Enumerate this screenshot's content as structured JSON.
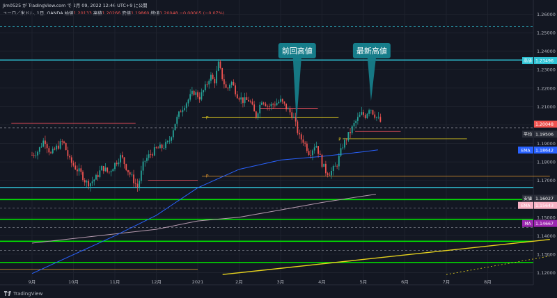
{
  "header": {
    "publish": "Jim0525 が TradingView.com で 2月 09, 2022 12:46 UTC+9 に公開",
    "symbol": "ユーロ／米ドル, 1日, OANDA",
    "open_label": "始値",
    "open": "1.20133",
    "high_label": "高値",
    "high": "1.20266",
    "low_label": "安値",
    "low": "1.19860",
    "close_label": "終値",
    "close": "1.20048",
    "change": "−0.00085 (−0.07%)"
  },
  "footer": {
    "brand": "TradingView"
  },
  "colors": {
    "background": "#131722",
    "up": "#26a69a",
    "down": "#ef5350",
    "cyan_line": "#2fc4d6",
    "green_line": "#00e600",
    "yellow_line": "#e6d21e",
    "ema_line": "#2962ff",
    "sma_line": "#b79bb0",
    "callout": "#167d8a"
  },
  "chart_data": {
    "type": "candlestick",
    "y_ticks": [
      "1.26000",
      "1.25000",
      "1.24000",
      "1.23000",
      "1.22000",
      "1.21000",
      "1.20000",
      "1.19000",
      "1.18000",
      "1.17000",
      "1.16000",
      "1.15000",
      "1.14000",
      "1.13000",
      "1.12000"
    ],
    "x_ticks": [
      "9月",
      "10月",
      "11月",
      "12月",
      "2021",
      "2月",
      "3月",
      "4月",
      "5月",
      "6月",
      "7月",
      "8月"
    ],
    "ylim": [
      1.1172,
      1.2652
    ],
    "price_labels": [
      {
        "name": "高値",
        "value": "1.23496",
        "price": 1.23496,
        "color": "#2fc4d6"
      },
      {
        "name": "",
        "value": "1.20048",
        "price": 1.20048,
        "color": "#ef5350"
      },
      {
        "name": "平均",
        "value": "1.19506",
        "price": 1.19506,
        "color": "#2a2e39"
      },
      {
        "name": "EMA",
        "value": "1.18642",
        "price": 1.18642,
        "color": "#2962ff"
      },
      {
        "name": "安値",
        "value": "1.16027",
        "price": 1.16027,
        "color": "#2a2e39"
      },
      {
        "name": "EMA",
        "value": "1.15643",
        "price": 1.15643,
        "color": "#f7b2c4"
      },
      {
        "name": "MA",
        "value": "1.14667",
        "price": 1.14667,
        "color": "#9c27b0"
      }
    ],
    "horizontal_lines": [
      {
        "price": 1.2352,
        "color": "#2fc4d6",
        "style": "solid"
      },
      {
        "price": 1.1661,
        "color": "#2fc4d6",
        "style": "solid"
      },
      {
        "price": 1.1596,
        "color": "#00e600",
        "style": "solid"
      },
      {
        "price": 1.1489,
        "color": "#00e600",
        "style": "solid"
      },
      {
        "price": 1.137,
        "color": "#00e600",
        "style": "solid"
      },
      {
        "price": 1.1255,
        "color": "#00e600",
        "style": "solid"
      },
      {
        "price": 1.2532,
        "color": "#2fc4d6",
        "style": "dashed"
      },
      {
        "price": 1.155,
        "color": "#787b86",
        "style": "dashed"
      },
      {
        "price": 1.1445,
        "color": "#787b86",
        "style": "dashed"
      },
      {
        "price": 1.132,
        "color": "#787b86",
        "style": "dashed"
      },
      {
        "price": 1.1985,
        "color": "#787b86",
        "style": "dashed"
      }
    ],
    "callouts": [
      {
        "text": "前回高値",
        "x_month": 6.4,
        "price": 1.2012
      },
      {
        "text": "最新高値",
        "x_month": 8.2,
        "price": 1.213
      }
    ],
    "pivot_marks": [
      {
        "text": "P",
        "x_month": 4.2,
        "price": 1.204,
        "color": "#e6d21e"
      },
      {
        "text": "P",
        "x_month": 7.4,
        "price": 1.1922,
        "color": "#e6d21e"
      },
      {
        "text": "P",
        "x_month": 4.2,
        "price": 1.1723,
        "color": "#f0a030"
      }
    ],
    "close_path": [
      [
        0,
        1.1838
      ],
      [
        0.15,
        1.186
      ],
      [
        0.3,
        1.1925
      ],
      [
        0.45,
        1.184
      ],
      [
        0.6,
        1.188
      ],
      [
        0.75,
        1.1912
      ],
      [
        0.9,
        1.181
      ],
      [
        1.05,
        1.1768
      ],
      [
        1.2,
        1.1732
      ],
      [
        1.3,
        1.1688
      ],
      [
        1.4,
        1.1685
      ],
      [
        1.55,
        1.1715
      ],
      [
        1.7,
        1.1772
      ],
      [
        1.85,
        1.174
      ],
      [
        2.0,
        1.179
      ],
      [
        2.15,
        1.1832
      ],
      [
        2.3,
        1.1758
      ],
      [
        2.45,
        1.17
      ],
      [
        2.55,
        1.1663
      ],
      [
        2.7,
        1.18
      ],
      [
        2.85,
        1.184
      ],
      [
        3.0,
        1.187
      ],
      [
        3.15,
        1.188
      ],
      [
        3.3,
        1.1905
      ],
      [
        3.45,
        1.201
      ],
      [
        3.6,
        1.2085
      ],
      [
        3.75,
        1.213
      ],
      [
        3.9,
        1.218
      ],
      [
        4.05,
        1.215
      ],
      [
        4.2,
        1.221
      ],
      [
        4.3,
        1.227
      ],
      [
        4.4,
        1.223
      ],
      [
        4.5,
        1.233
      ],
      [
        4.6,
        1.225
      ],
      [
        4.7,
        1.2185
      ],
      [
        4.8,
        1.224
      ],
      [
        4.95,
        1.2165
      ],
      [
        5.1,
        1.213
      ],
      [
        5.25,
        1.2135
      ],
      [
        5.4,
        1.2045
      ],
      [
        5.55,
        1.214
      ],
      [
        5.7,
        1.21
      ],
      [
        5.85,
        1.2115
      ],
      [
        6.0,
        1.213
      ],
      [
        6.15,
        1.209
      ],
      [
        6.3,
        1.205
      ],
      [
        6.45,
        1.1935
      ],
      [
        6.55,
        1.1915
      ],
      [
        6.7,
        1.1845
      ],
      [
        6.85,
        1.19
      ],
      [
        7.0,
        1.1792
      ],
      [
        7.1,
        1.1745
      ],
      [
        7.2,
        1.1742
      ],
      [
        7.35,
        1.178
      ],
      [
        7.5,
        1.189
      ],
      [
        7.65,
        1.195
      ],
      [
        7.8,
        1.2015
      ],
      [
        7.95,
        1.206
      ],
      [
        8.05,
        1.205
      ],
      [
        8.15,
        1.21
      ],
      [
        8.25,
        1.206
      ],
      [
        8.35,
        1.2035
      ],
      [
        8.45,
        1.2005
      ]
    ],
    "ema_line": [
      [
        0,
        1.1195
      ],
      [
        2,
        1.14
      ],
      [
        3,
        1.151
      ],
      [
        4,
        1.166
      ],
      [
        5,
        1.176
      ],
      [
        6,
        1.181
      ],
      [
        7,
        1.183
      ],
      [
        8,
        1.1855
      ],
      [
        8.35,
        1.1865
      ]
    ],
    "sma_line": [
      [
        0,
        1.136
      ],
      [
        3,
        1.1435
      ],
      [
        4,
        1.148
      ],
      [
        5,
        1.15
      ],
      [
        6,
        1.154
      ],
      [
        7,
        1.158
      ],
      [
        8,
        1.1615
      ],
      [
        8.3,
        1.1625
      ]
    ],
    "trend_yellow": [
      [
        4.6,
        1.119
      ],
      [
        12.5,
        1.138
      ]
    ],
    "trend_dotted": [
      [
        10,
        1.119
      ],
      [
        12.5,
        1.129
      ]
    ]
  }
}
